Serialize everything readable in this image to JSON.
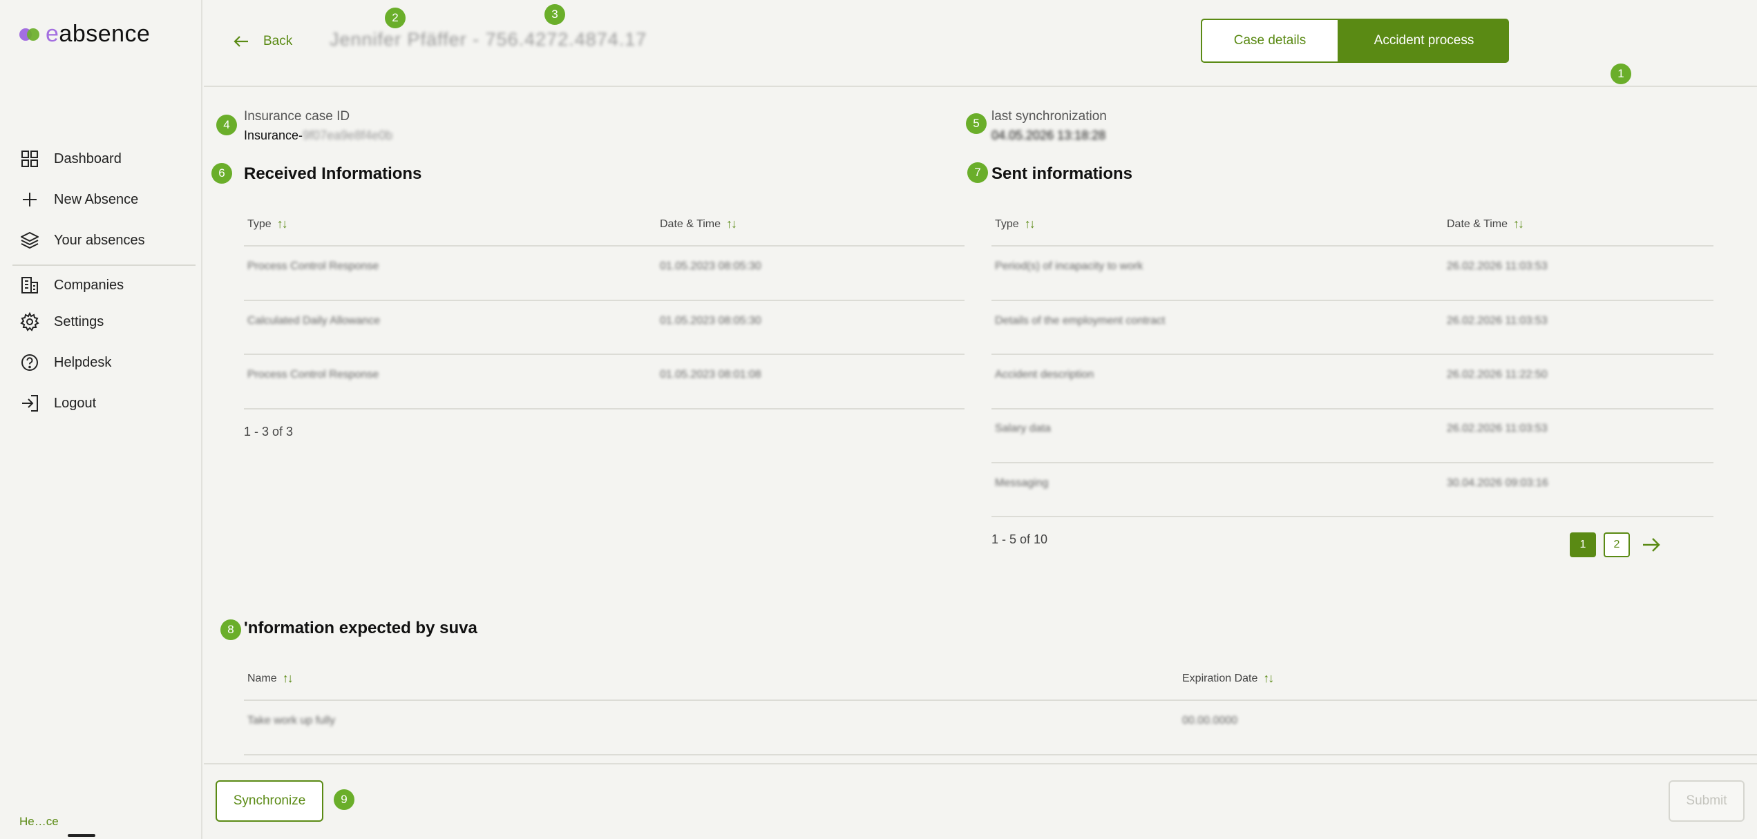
{
  "brand": {
    "name_prefix": "e",
    "name_suffix": "absence"
  },
  "sidebar": {
    "items": [
      {
        "label": "Dashboard",
        "icon": "grid-icon"
      },
      {
        "label": "New Absence",
        "icon": "plus-icon"
      },
      {
        "label": "Your absences",
        "icon": "layers-icon"
      },
      {
        "label": "Companies",
        "icon": "building-icon"
      },
      {
        "label": "Settings",
        "icon": "gear-icon"
      },
      {
        "label": "Helpdesk",
        "icon": "help-circle-icon"
      },
      {
        "label": "Logout",
        "icon": "logout-icon"
      }
    ],
    "footer_text": "He…ce"
  },
  "header": {
    "back_label": "Back",
    "title_blurred": "Jennifer Pfäffer - 756.4272.4874.17",
    "case_details_label": "Case details",
    "accident_process_label": "Accident process"
  },
  "badges": [
    "1",
    "2",
    "3",
    "4",
    "5",
    "6",
    "7",
    "8",
    "9"
  ],
  "meta": {
    "insurance_label": "Insurance case ID",
    "insurance_value_prefix": "Insurance-",
    "insurance_value_blurred": "9f07ea9e8f4e0b",
    "sync_label": "last synchronization",
    "sync_value_blurred": "04.05.2026 13:18:28"
  },
  "received": {
    "title": "Received Informations",
    "col_type": "Type",
    "col_date": "Date & Time",
    "rows": [
      {
        "type": "Process Control Response",
        "date": "01.05.2023 08:05:30"
      },
      {
        "type": "Calculated Daily Allowance",
        "date": "01.05.2023 08:05:30"
      },
      {
        "type": "Process Control Response",
        "date": "01.05.2023 08:01:08"
      }
    ],
    "count": "1 - 3 of 3"
  },
  "sent": {
    "title": "Sent informations",
    "col_type": "Type",
    "col_date": "Date & Time",
    "rows": [
      {
        "type": "Period(s) of incapacity to work",
        "date": "26.02.2026 11:03:53"
      },
      {
        "type": "Details of the employment contract",
        "date": "26.02.2026 11:03:53"
      },
      {
        "type": "Accident description",
        "date": "26.02.2026 11:22:50"
      },
      {
        "type": "Salary data",
        "date": "26.02.2026 11:03:53"
      },
      {
        "type": "Messaging",
        "date": "30.04.2026 09:03:16"
      }
    ],
    "count": "1 - 5 of 10",
    "pages": [
      "1",
      "2"
    ]
  },
  "expected": {
    "title": "'nformation expected by suva",
    "col_name": "Name",
    "col_expiration": "Expiration Date",
    "rows": [
      {
        "name": "Take work up fully",
        "date": "00.00.0000"
      }
    ]
  },
  "footer": {
    "sync_label": "Synchronize",
    "submit_label": "Submit"
  },
  "colors": {
    "accent": "#5a8a14",
    "badge": "#6aae2a",
    "logo_purple": "#a36ee0"
  }
}
